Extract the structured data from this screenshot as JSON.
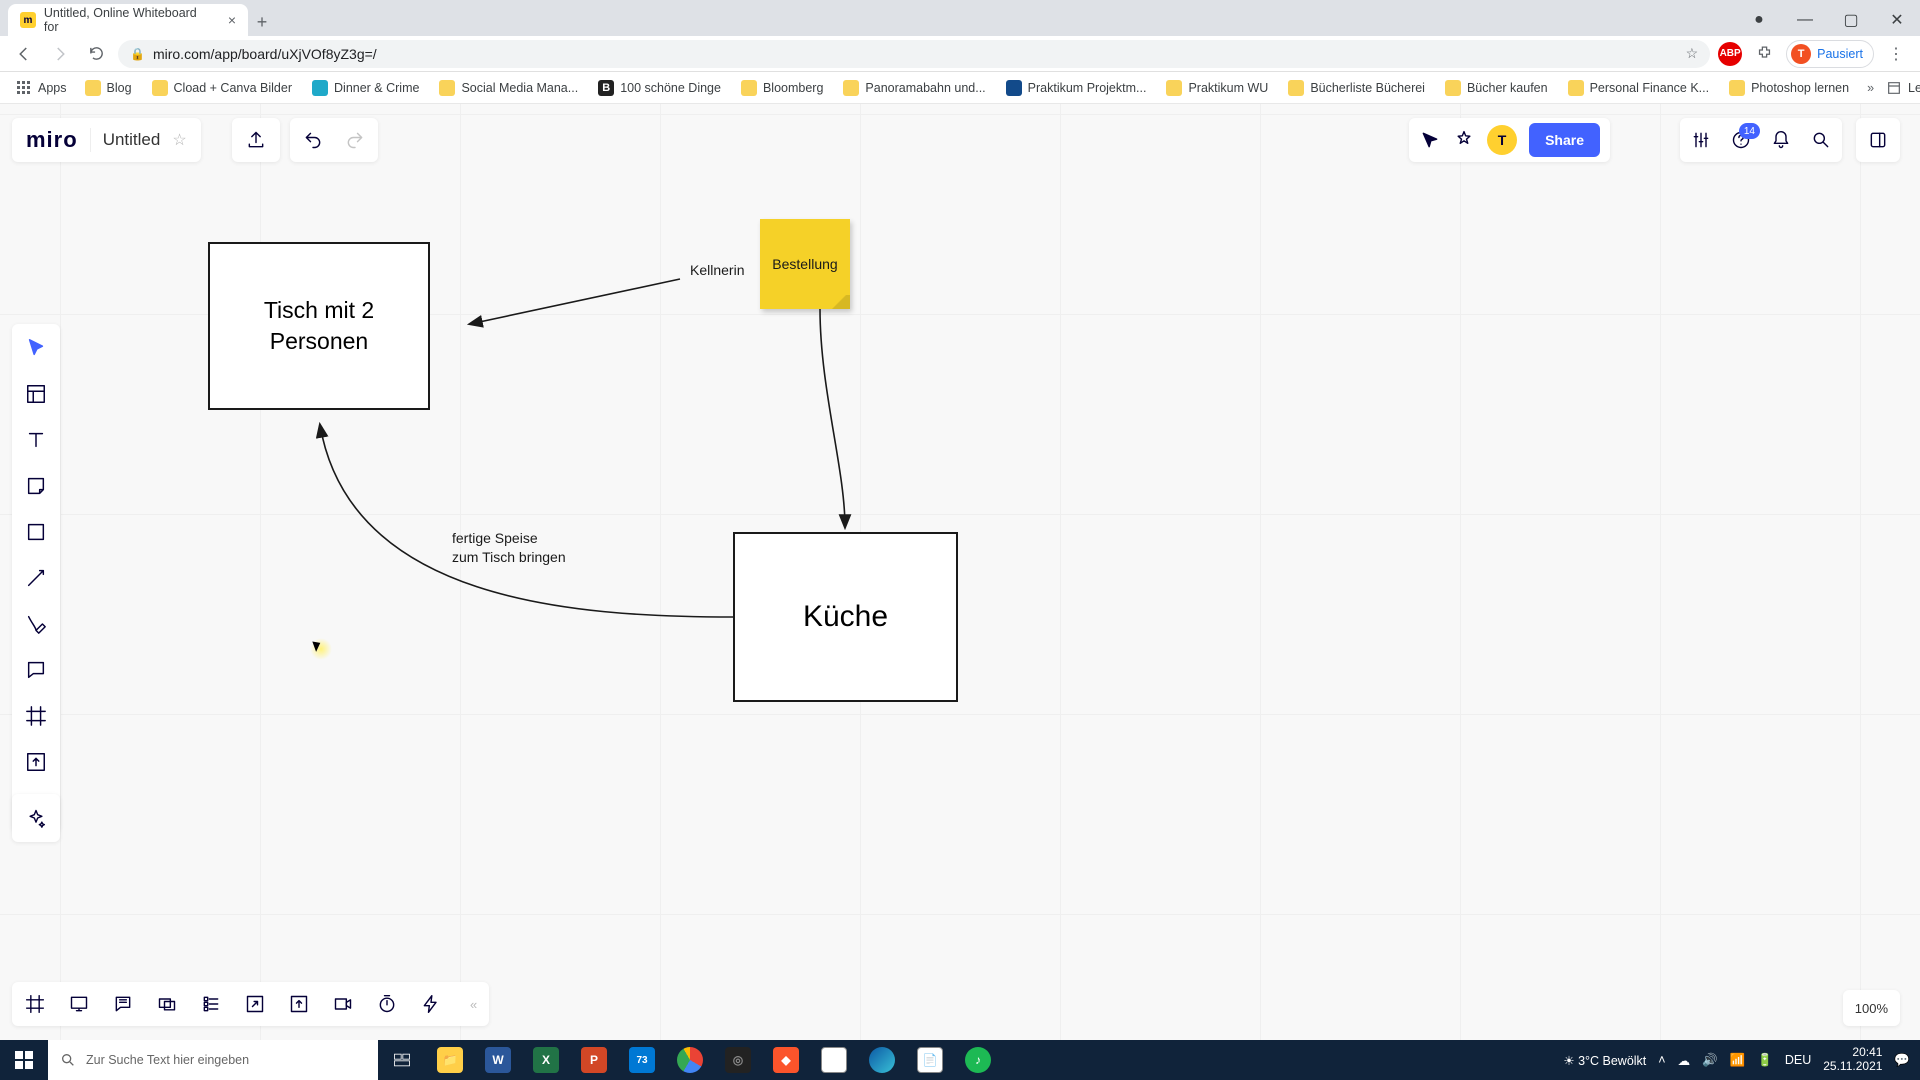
{
  "browser": {
    "tab_title": "Untitled, Online Whiteboard for",
    "url": "miro.com/app/board/uXjVOf8yZ3g=/",
    "profile_label": "Pausiert",
    "profile_initial": "T",
    "bookmarks": [
      "Apps",
      "Blog",
      "Cload + Canva Bilder",
      "Dinner & Crime",
      "Social Media Mana...",
      "100 schöne Dinge",
      "Bloomberg",
      "Panoramabahn und...",
      "Praktikum Projektm...",
      "Praktikum WU",
      "Bücherliste Bücherei",
      "Bücher kaufen",
      "Personal Finance K...",
      "Photoshop lernen"
    ],
    "reading_list": "Leseliste"
  },
  "miro": {
    "logo": "miro",
    "board_title": "Untitled",
    "share_label": "Share",
    "help_badge": "14",
    "avatar_initial": "T",
    "zoom": "100%"
  },
  "board": {
    "box_tisch": "Tisch mit 2\nPersonen",
    "box_kueche": "Küche",
    "sticky_bestellung": "Bestellung",
    "text_kellnerin": "Kellnerin",
    "text_speise": "fertige Speise\nzum Tisch bringen"
  },
  "taskbar": {
    "search_placeholder": "Zur Suche Text hier eingeben",
    "weather": "3°C  Bewölkt",
    "lang": "DEU",
    "time": "20:41",
    "date": "25.11.2021",
    "calendar_badge": "73"
  }
}
